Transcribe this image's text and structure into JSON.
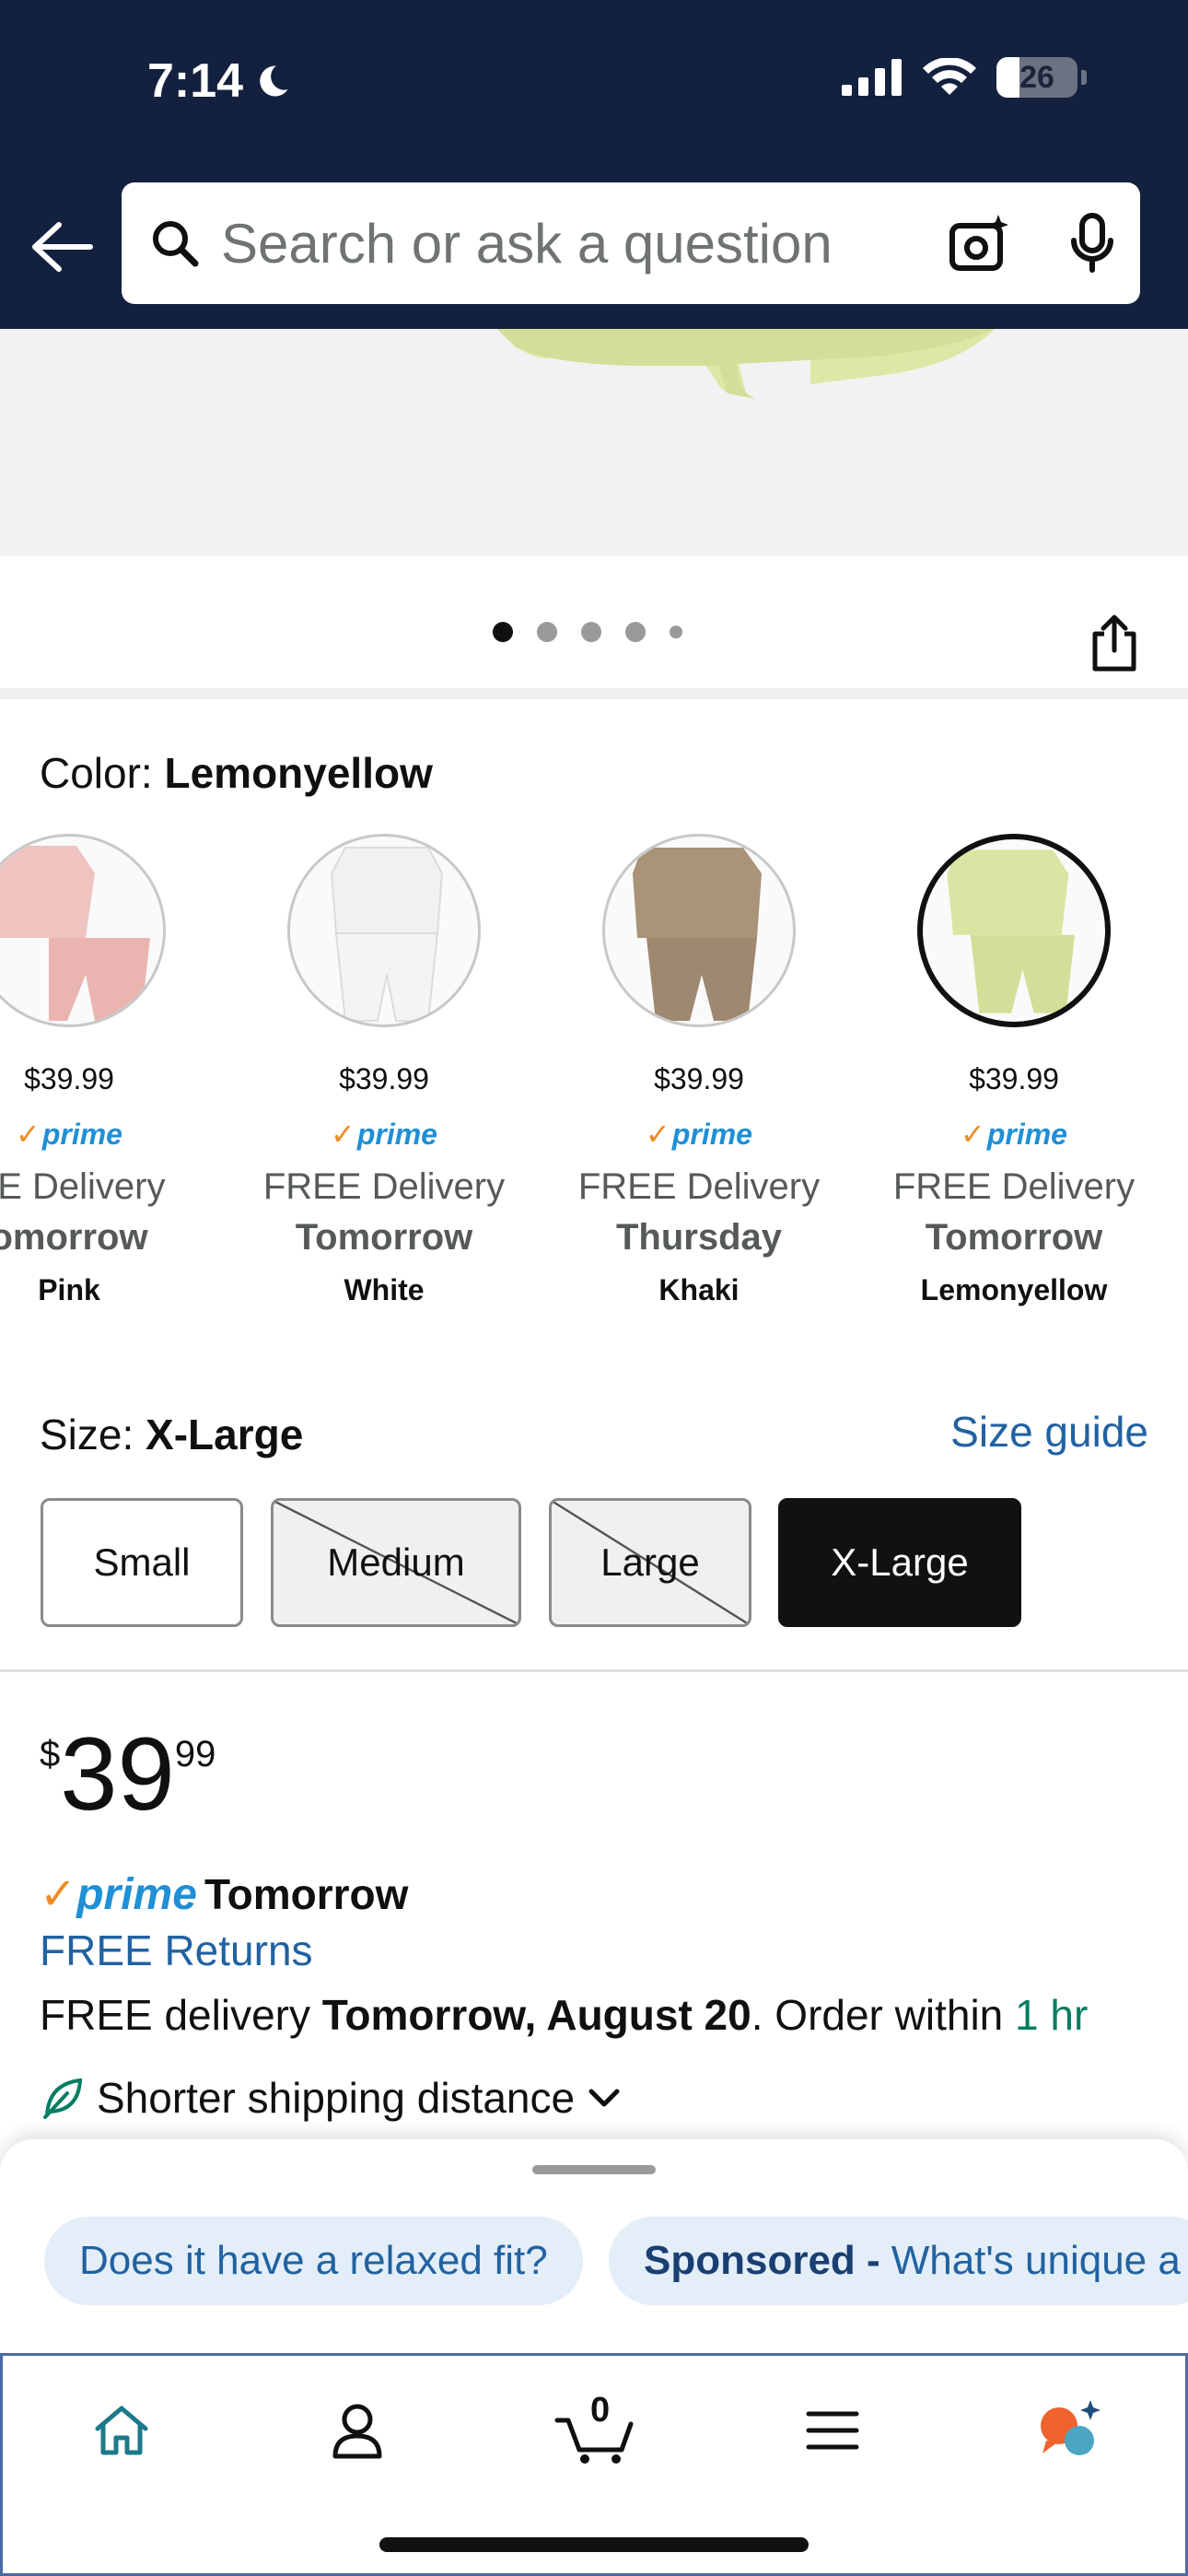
{
  "status_bar": {
    "time": "7:14",
    "battery": "26"
  },
  "search": {
    "placeholder": "Search or ask a question"
  },
  "gallery": {
    "image_count": 5,
    "active_index": 0
  },
  "color": {
    "label": "Color: ",
    "selected": "Lemonyellow",
    "swatches": [
      {
        "price": "$39.99",
        "prime": "prime",
        "delivery": "EE Delivery",
        "day": "omorrow",
        "name": "Pink",
        "color": "#efc3c0"
      },
      {
        "price": "$39.99",
        "prime": "prime",
        "delivery": "FREE Delivery",
        "day": "Tomorrow",
        "name": "White",
        "color": "#f7f7f5"
      },
      {
        "price": "$39.99",
        "prime": "prime",
        "delivery": "FREE Delivery",
        "day": "Thursday",
        "name": "Khaki",
        "color": "#a99379"
      },
      {
        "price": "$39.99",
        "prime": "prime",
        "delivery": "FREE Delivery",
        "day": "Tomorrow",
        "name": "Lemonyellow",
        "color": "#d8e39e"
      }
    ]
  },
  "size": {
    "label": "Size: ",
    "selected": "X-Large",
    "guide": "Size guide",
    "options": [
      "Small",
      "Medium",
      "Large",
      "X-Large"
    ]
  },
  "price": {
    "currency": "$",
    "whole": "39",
    "fraction": "99"
  },
  "prime_line": {
    "logo": "prime",
    "day": "Tomorrow"
  },
  "free_returns": "FREE Returns",
  "delivery": {
    "prefix": "FREE delivery ",
    "date": "Tomorrow, August 20",
    "middle": ". Order within ",
    "countdown": "1 hr"
  },
  "shipping": {
    "label": "Shorter shipping distance"
  },
  "chips": [
    {
      "sponsor": "",
      "text": "Does it have a relaxed fit?"
    },
    {
      "sponsor": "Sponsored -",
      "text": "What's unique a"
    }
  ],
  "cart": {
    "count": "0"
  },
  "colors": {
    "header_bg": "#13213f",
    "link": "#2162a1",
    "prime_blue": "#1f8fd6",
    "prime_check": "#f08a24",
    "green": "#067d62"
  },
  "nav_icons": [
    "home-icon",
    "account-icon",
    "cart-icon",
    "menu-icon",
    "rufus-icon"
  ]
}
